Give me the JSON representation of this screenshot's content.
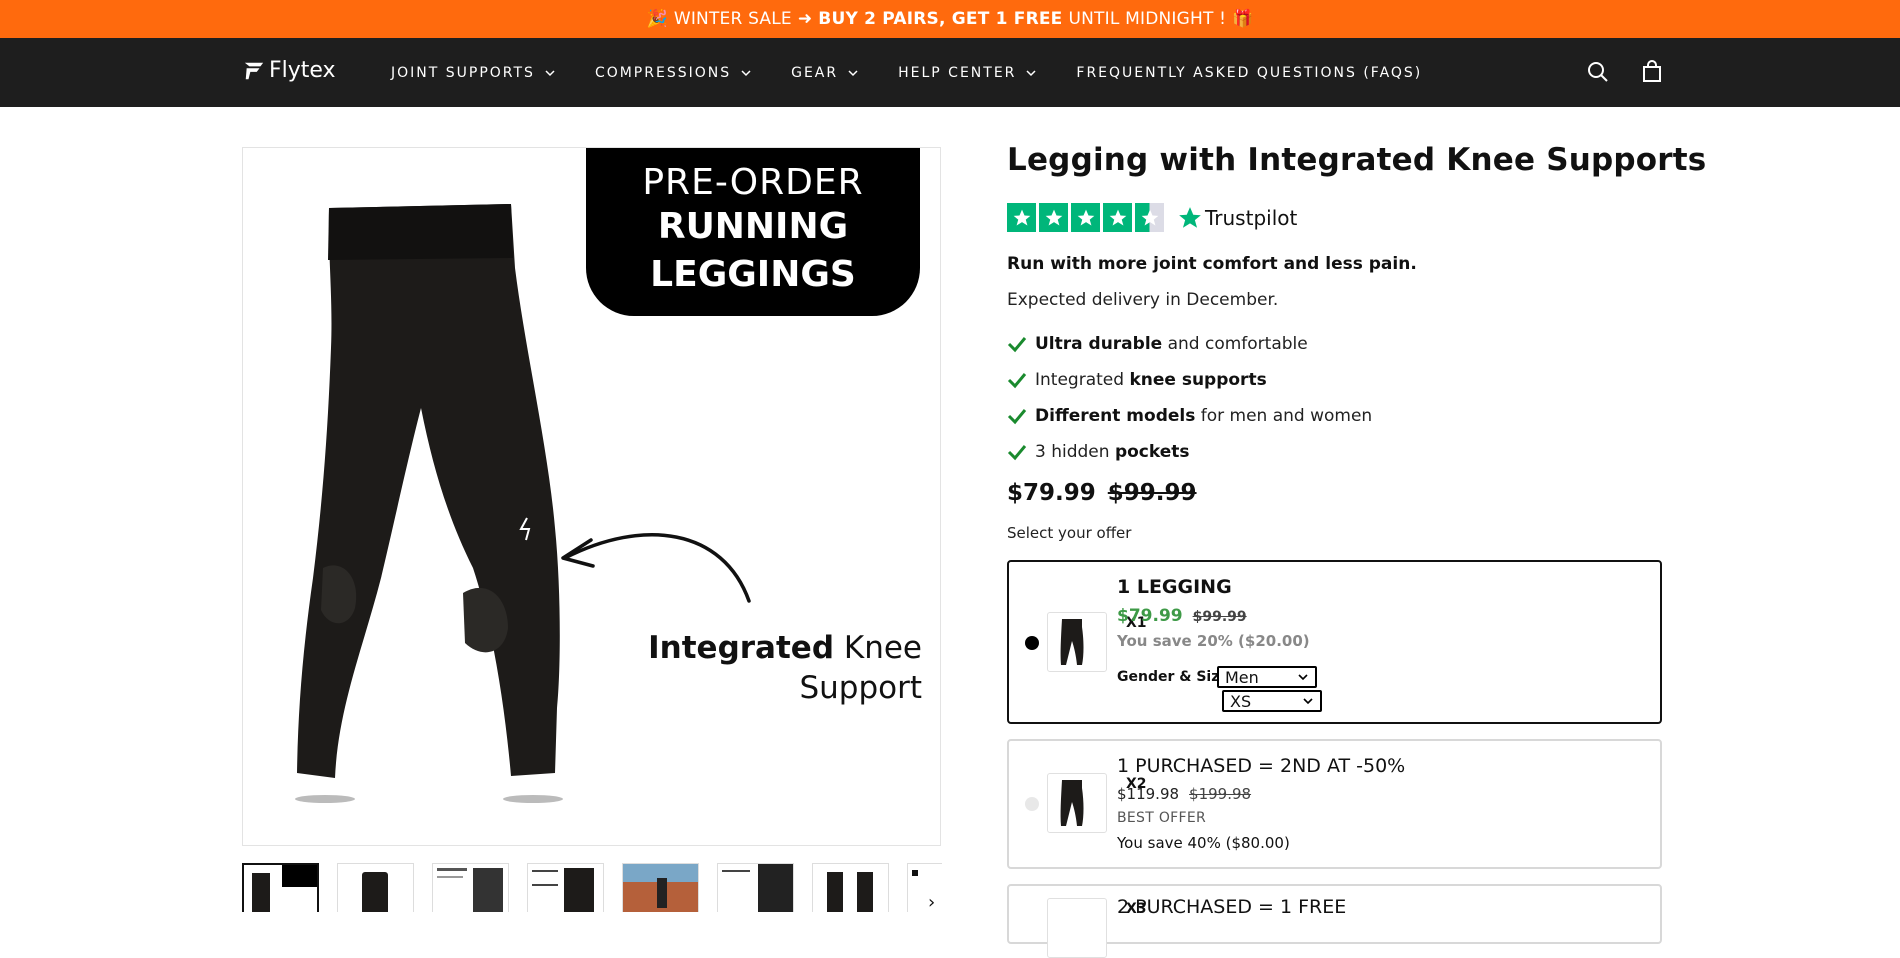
{
  "promo": {
    "emoji_left": "🎉",
    "text_pre": "WINTER SALE",
    "arrow": "➜",
    "text_bold": "BUY 2 PAIRS, GET 1 FREE",
    "text_post": "UNTIL MIDNIGHT !",
    "emoji_right": "🎁",
    "bg_color": "#ff6a0d"
  },
  "nav": {
    "logo": "Flytex",
    "items": [
      {
        "label": "JOINT SUPPORTS",
        "dropdown": true
      },
      {
        "label": "COMPRESSIONS",
        "dropdown": true
      },
      {
        "label": "GEAR",
        "dropdown": true
      },
      {
        "label": "HELP CENTER",
        "dropdown": true
      },
      {
        "label": "FREQUENTLY ASKED QUESTIONS (FAQS)",
        "dropdown": false
      }
    ],
    "icons": [
      "search-icon",
      "cart-icon"
    ]
  },
  "gallery": {
    "preorder_line1": "PRE-ORDER",
    "preorder_line2": "RUNNING",
    "preorder_line3": "LEGGINGS",
    "knee_bold": "Integrated",
    "knee_rest": "Knee",
    "knee_line2": "Support",
    "thumb_count": 8,
    "next_icon": "chevron-right-icon"
  },
  "product": {
    "title": "Legging with Integrated Knee Supports",
    "trustpilot": {
      "label": "Trustpilot",
      "stars": 4.5
    },
    "lead": "Run with more joint comfort and less pain.",
    "delivery": "Expected delivery in December.",
    "bullets": [
      {
        "bold": "Ultra durable",
        "rest": " and comfortable",
        "bold_first": true
      },
      {
        "bold": "knee supports",
        "rest": "Integrated ",
        "bold_first": false
      },
      {
        "bold": "Different models",
        "rest": " for men and women",
        "bold_first": true
      },
      {
        "bold": "pockets",
        "rest": "3 hidden ",
        "bold_first": false
      }
    ],
    "price": "$79.99",
    "compare_price": "$99.99",
    "offer_label": "Select your offer"
  },
  "offers": [
    {
      "qty": "X1",
      "title": "1 LEGGING",
      "price": "$79.99",
      "was": "$99.99",
      "save": "You save 20% ($20.00)",
      "gender_size_label": "Gender & Size",
      "gender": "Men",
      "size": "XS"
    },
    {
      "qty": "X2",
      "title": "1 PURCHASED = 2ND AT -50%",
      "price": "$119.98",
      "was": "$199.98",
      "badge": "BEST OFFER",
      "save": "You save 40% ($80.00)"
    },
    {
      "qty": "X3",
      "title": "2 PURCHASED = 1 FREE"
    }
  ]
}
